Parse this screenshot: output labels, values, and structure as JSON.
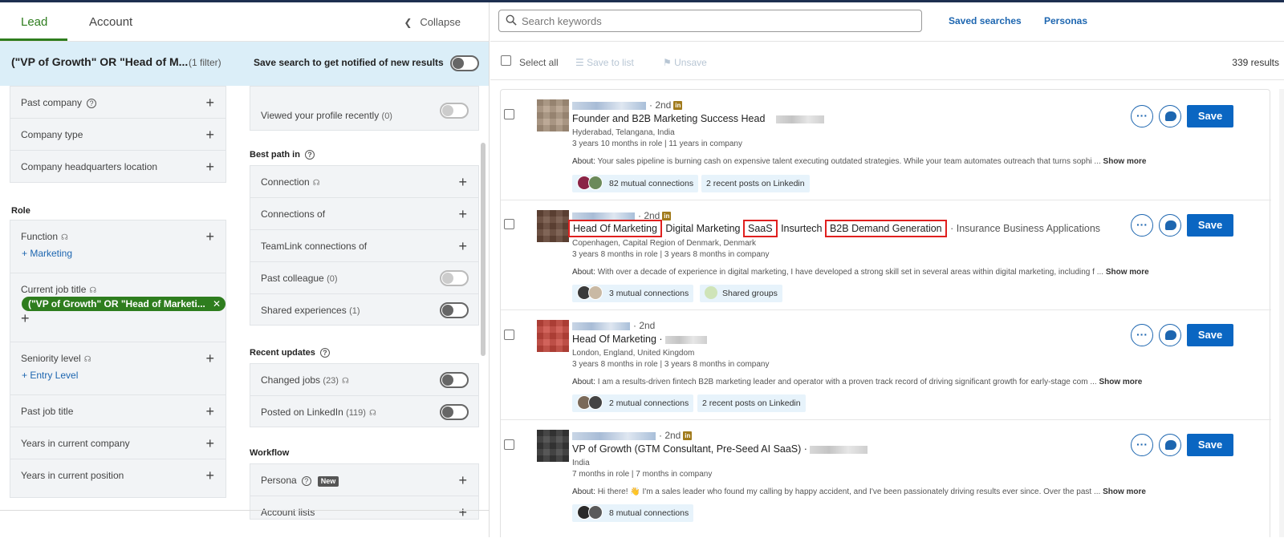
{
  "tabs": {
    "lead": "Lead",
    "account": "Account",
    "collapse": "Collapse"
  },
  "query": {
    "text": "(\"VP of Growth\" OR \"Head of M...",
    "count": "(1 filter)",
    "save_search": "Save search to get notified of new results"
  },
  "filters_left": {
    "past_company": "Past company",
    "company_type": "Company type",
    "company_hq": "Company headquarters location",
    "role_title": "Role",
    "function": "Function",
    "function_value": "Marketing",
    "current_job_title": "Current job title",
    "current_job_title_value": "(\"VP of Growth\" OR \"Head of Marketi...",
    "seniority_level": "Seniority level",
    "seniority_value": "Entry Level",
    "past_job_title": "Past job title",
    "years_in_company": "Years in current company",
    "years_in_position": "Years in current position"
  },
  "filters_right": {
    "viewed_profile": "Viewed your profile recently",
    "viewed_profile_count": "(0)",
    "best_path_title": "Best path in",
    "connection": "Connection",
    "connections_of": "Connections of",
    "teamlink": "TeamLink connections of",
    "past_colleague": "Past colleague",
    "past_colleague_count": "(0)",
    "shared_experiences": "Shared experiences",
    "shared_experiences_count": "(1)",
    "recent_updates_title": "Recent updates",
    "changed_jobs": "Changed jobs",
    "changed_jobs_count": "(23)",
    "posted_linkedin": "Posted on LinkedIn",
    "posted_linkedin_count": "(119)",
    "workflow_title": "Workflow",
    "persona": "Persona",
    "new_badge": "New",
    "account_lists": "Account lists"
  },
  "header": {
    "search_placeholder": "Search keywords",
    "saved_searches": "Saved searches",
    "personas": "Personas"
  },
  "toolbar": {
    "select_all": "Select all",
    "save_to_list": "Save to list",
    "unsave": "Unsave",
    "results": "339 results"
  },
  "results": [
    {
      "degree": "· 2nd",
      "title": "Founder and B2B Marketing Success Head",
      "location": "Hyderabad, Telangana, India",
      "tenure": "3 years 10 months in role | 11 years in company",
      "about_label": "About:",
      "about": "Your sales pipeline is burning cash on expensive talent executing outdated strategies. While your team automates outreach that turns sophi ...",
      "show_more": "Show more",
      "chip1": "82 mutual connections",
      "chip2": "2 recent posts on Linkedin",
      "save": "Save"
    },
    {
      "degree": "· 2nd",
      "title_parts": [
        "Head Of Marketing",
        "Digital Marketing",
        "SaaS",
        "Insurtech",
        "B2B Demand Generation",
        "· Insurance Business Applications"
      ],
      "location": "Copenhagen, Capital Region of Denmark, Denmark",
      "tenure": "3 years 8 months in role | 3 years 8 months in company",
      "about_label": "About:",
      "about": "With over a decade of experience in digital marketing, I have developed a strong skill set in several areas within digital marketing, including f ...",
      "show_more": "Show more",
      "chip1": "3 mutual connections",
      "chip2": "Shared groups",
      "save": "Save"
    },
    {
      "degree": "· 2nd",
      "title": "Head Of Marketing ·",
      "location": "London, England, United Kingdom",
      "tenure": "3 years 8 months in role | 3 years 8 months in company",
      "about_label": "About:",
      "about": "I am a results-driven fintech B2B marketing leader and operator with a proven track record of driving significant growth for early-stage com ...",
      "show_more": "Show more",
      "chip1": "2 mutual connections",
      "chip2": "2 recent posts on Linkedin",
      "save": "Save"
    },
    {
      "degree": "· 2nd",
      "title": "VP of Growth (GTM Consultant, Pre-Seed AI SaaS) ·",
      "location": "India",
      "tenure": "7 months in role | 7 months in company",
      "about_label": "About:",
      "about": "Hi there! 👋 I'm a sales leader who found my calling by happy accident, and I've been passionately driving results ever since. Over the past ...",
      "show_more": "Show more",
      "chip1": "8 mutual connections",
      "save": "Save"
    }
  ],
  "colors": {
    "accent_green": "#2e7d1e",
    "link_blue": "#1d66b0",
    "save_blue": "#0a66c2",
    "highlight_red": "#e0201f",
    "query_bg": "#dbeef8"
  },
  "icons": [
    "collapse-chevron-icon",
    "help-icon",
    "pin-icon",
    "plus-icon",
    "search-icon",
    "list-icon",
    "bookmark-icon",
    "more-icon",
    "message-icon",
    "linkedin-badge-icon"
  ]
}
